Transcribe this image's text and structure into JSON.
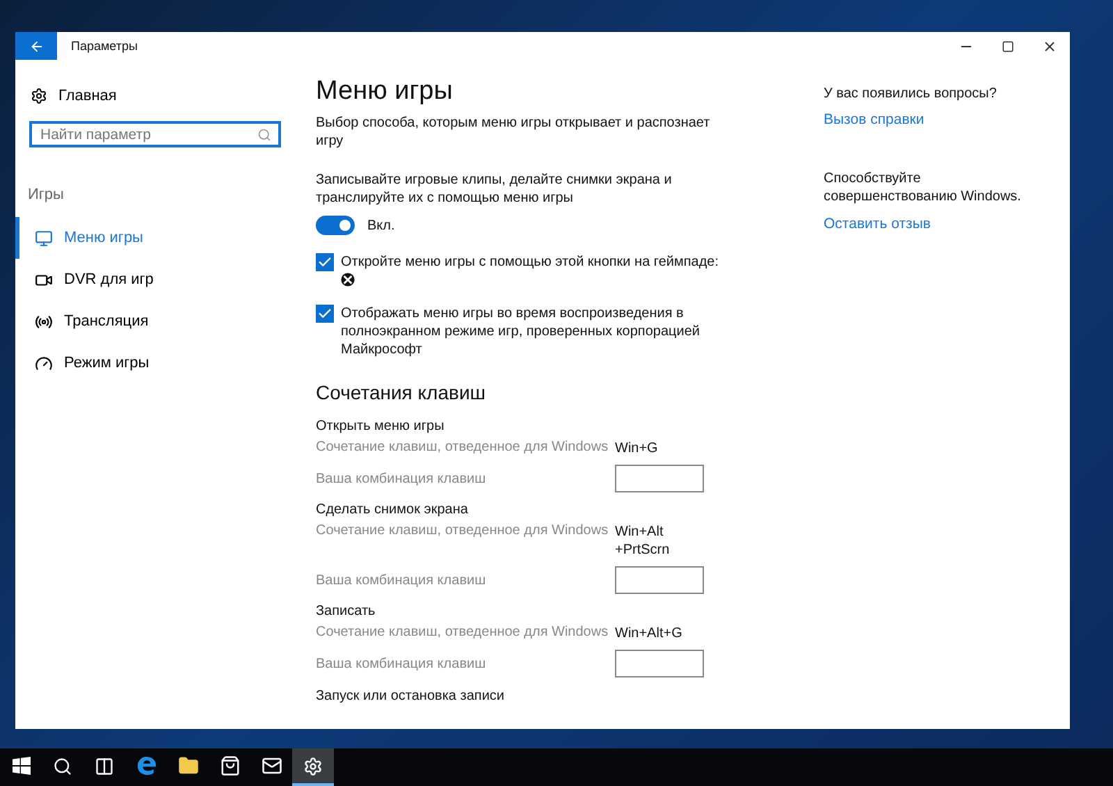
{
  "window": {
    "title": "Параметры"
  },
  "sidebar": {
    "home": "Главная",
    "search": {
      "placeholder": "Найти параметр"
    },
    "section": "Игры",
    "items": [
      {
        "label": "Меню игры",
        "kind": "menu",
        "selected": true
      },
      {
        "label": "DVR для игр",
        "kind": "dvr",
        "selected": false
      },
      {
        "label": "Трансляция",
        "kind": "broadcast",
        "selected": false
      },
      {
        "label": "Режим игры",
        "kind": "mode",
        "selected": false
      }
    ]
  },
  "main": {
    "title": "Меню игры",
    "description": "Выбор способа, которым меню игры открывает и распознает игру",
    "toggle_setting": {
      "label": "Записывайте игровые клипы, делайте снимки экрана и транслируйте их с помощью меню игры",
      "on": true,
      "state_text": "Вкл."
    },
    "checkboxes": [
      {
        "label": "Откройте меню игры с помощью этой кнопки на геймпаде:",
        "kind": "gamepad",
        "checked": true
      },
      {
        "label": "Отображать меню игры во время воспроизведения в полноэкранном режиме игр, проверенных корпорацией Майкрософт",
        "kind": "plain",
        "checked": true
      }
    ],
    "shortcuts": {
      "heading": "Сочетания клавиш",
      "groups": [
        {
          "title": "Открыть меню игры",
          "default_label": "Сочетание клавиш, отведенное для Windows",
          "default_keys": "Win+G",
          "custom_label": "Ваша комбинация клавиш"
        },
        {
          "title": "Сделать снимок экрана",
          "default_label": "Сочетание клавиш, отведенное для Windows",
          "default_keys": "Win+Alt\n+PrtScrn",
          "custom_label": "Ваша комбинация клавиш"
        },
        {
          "title": "Записать",
          "default_label": "Сочетание клавиш, отведенное для Windows",
          "default_keys": "Win+Alt+G",
          "custom_label": "Ваша комбинация клавиш"
        }
      ],
      "next_title": "Запуск или остановка записи"
    }
  },
  "aside": {
    "help": {
      "question": "У вас появились вопросы?",
      "link": "Вызов справки"
    },
    "feedback": {
      "text": "Способствуйте совершенствованию Windows.",
      "link": "Оставить отзыв"
    }
  },
  "taskbar": [
    {
      "kind": "start",
      "selected": false
    },
    {
      "kind": "search",
      "selected": false
    },
    {
      "kind": "taskview",
      "selected": false
    },
    {
      "kind": "edge",
      "selected": false
    },
    {
      "kind": "explorer",
      "selected": false
    },
    {
      "kind": "store",
      "selected": false
    },
    {
      "kind": "mail",
      "selected": false
    },
    {
      "kind": "settings",
      "selected": true
    }
  ]
}
